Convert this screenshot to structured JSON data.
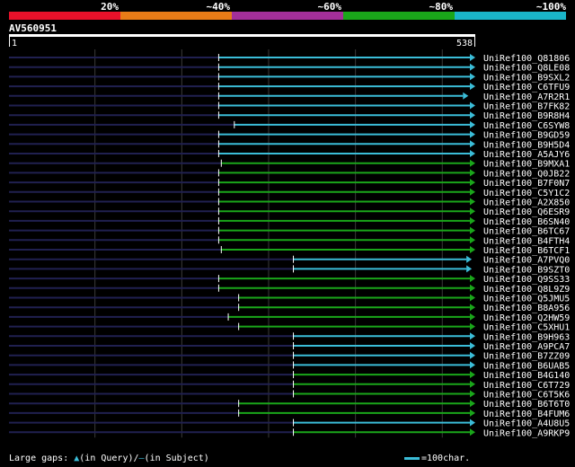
{
  "score_scale": [
    {
      "label": "",
      "color": "#e8112a"
    },
    {
      "label": "20%",
      "color": "#e87c17"
    },
    {
      "label": "~40%",
      "color": "#a32f99"
    },
    {
      "label": "~60%",
      "color": "#1aa61a"
    },
    {
      "label": "~80%",
      "color": "#1ab5c9"
    }
  ],
  "scale_end_label": "~100%",
  "query": {
    "name": "AV560951",
    "start": "1",
    "end": "538"
  },
  "colors": {
    "cyan": "#3bbdd8",
    "green": "#1aa61a",
    "navy": "#202050",
    "grid": "#3a3a3a",
    "ruler": "#ffffff"
  },
  "hits": [
    {
      "label": "UniRef100_Q81806",
      "start": 242,
      "end": 538,
      "color": "cyan"
    },
    {
      "label": "UniRef100_Q8LE08",
      "start": 242,
      "end": 538,
      "color": "cyan"
    },
    {
      "label": "UniRef100_B9SXL2",
      "start": 242,
      "end": 538,
      "color": "cyan"
    },
    {
      "label": "UniRef100_C6TFU9",
      "start": 242,
      "end": 538,
      "color": "cyan"
    },
    {
      "label": "UniRef100_A7R2R1",
      "start": 242,
      "end": 530,
      "color": "cyan"
    },
    {
      "label": "UniRef100_B7FK82",
      "start": 242,
      "end": 538,
      "color": "cyan"
    },
    {
      "label": "UniRef100_B9R8H4",
      "start": 242,
      "end": 538,
      "color": "cyan"
    },
    {
      "label": "UniRef100_C6SYW8",
      "start": 260,
      "end": 538,
      "color": "cyan"
    },
    {
      "label": "UniRef100_B9GD59",
      "start": 242,
      "end": 538,
      "color": "cyan"
    },
    {
      "label": "UniRef100_B9H5D4",
      "start": 242,
      "end": 538,
      "color": "cyan"
    },
    {
      "label": "UniRef100_A5AJY6",
      "start": 242,
      "end": 538,
      "color": "cyan"
    },
    {
      "label": "UniRef100_B9MXA1",
      "start": 245,
      "end": 538,
      "color": "green"
    },
    {
      "label": "UniRef100_Q0JB22",
      "start": 242,
      "end": 538,
      "color": "green"
    },
    {
      "label": "UniRef100_B7F0N7",
      "start": 242,
      "end": 538,
      "color": "green"
    },
    {
      "label": "UniRef100_C5Y1C2",
      "start": 242,
      "end": 538,
      "color": "green"
    },
    {
      "label": "UniRef100_A2X850",
      "start": 242,
      "end": 538,
      "color": "green"
    },
    {
      "label": "UniRef100_Q6ESR9",
      "start": 242,
      "end": 538,
      "color": "green"
    },
    {
      "label": "UniRef100_B6SN40",
      "start": 242,
      "end": 538,
      "color": "green"
    },
    {
      "label": "UniRef100_B6TC67",
      "start": 242,
      "end": 538,
      "color": "green"
    },
    {
      "label": "UniRef100_B4FTH4",
      "start": 242,
      "end": 538,
      "color": "green"
    },
    {
      "label": "UniRef100_B6TCF1",
      "start": 245,
      "end": 538,
      "color": "green"
    },
    {
      "label": "UniRef100_A7PVQ0",
      "start": 328,
      "end": 534,
      "color": "cyan"
    },
    {
      "label": "UniRef100_B9SZT0",
      "start": 328,
      "end": 534,
      "color": "cyan"
    },
    {
      "label": "UniRef100_Q9SS33",
      "start": 242,
      "end": 538,
      "color": "green"
    },
    {
      "label": "UniRef100_Q8L9Z9",
      "start": 242,
      "end": 538,
      "color": "green"
    },
    {
      "label": "UniRef100_Q5JMU5",
      "start": 265,
      "end": 538,
      "color": "green"
    },
    {
      "label": "UniRef100_B8A956",
      "start": 265,
      "end": 538,
      "color": "green"
    },
    {
      "label": "UniRef100_Q2HW59",
      "start": 253,
      "end": 538,
      "color": "green"
    },
    {
      "label": "UniRef100_C5XHU1",
      "start": 265,
      "end": 538,
      "color": "green"
    },
    {
      "label": "UniRef100_B9H963",
      "start": 328,
      "end": 538,
      "color": "cyan"
    },
    {
      "label": "UniRef100_A9PCA7",
      "start": 328,
      "end": 538,
      "color": "cyan"
    },
    {
      "label": "UniRef100_B7ZZ09",
      "start": 328,
      "end": 538,
      "color": "cyan"
    },
    {
      "label": "UniRef100_B6UAB5",
      "start": 328,
      "end": 538,
      "color": "cyan"
    },
    {
      "label": "UniRef100_B4G140",
      "start": 328,
      "end": 538,
      "color": "green"
    },
    {
      "label": "UniRef100_C6T729",
      "start": 328,
      "end": 538,
      "color": "green"
    },
    {
      "label": "UniRef100_C6T5K6",
      "start": 328,
      "end": 538,
      "color": "green"
    },
    {
      "label": "UniRef100_B6T6T0",
      "start": 265,
      "end": 538,
      "color": "green"
    },
    {
      "label": "UniRef100_B4FUM6",
      "start": 265,
      "end": 538,
      "color": "green"
    },
    {
      "label": "UniRef100_A4U8U5",
      "start": 328,
      "end": 538,
      "color": "cyan"
    },
    {
      "label": "UniRef100_A9RKP9",
      "start": 328,
      "end": 538,
      "color": "green"
    }
  ],
  "footer": {
    "prefix": "Large gaps: ",
    "query_gap_text": "(in Query)/",
    "subject_gap_text": "(in Subject)"
  },
  "legend": {
    "text": "=100char."
  }
}
